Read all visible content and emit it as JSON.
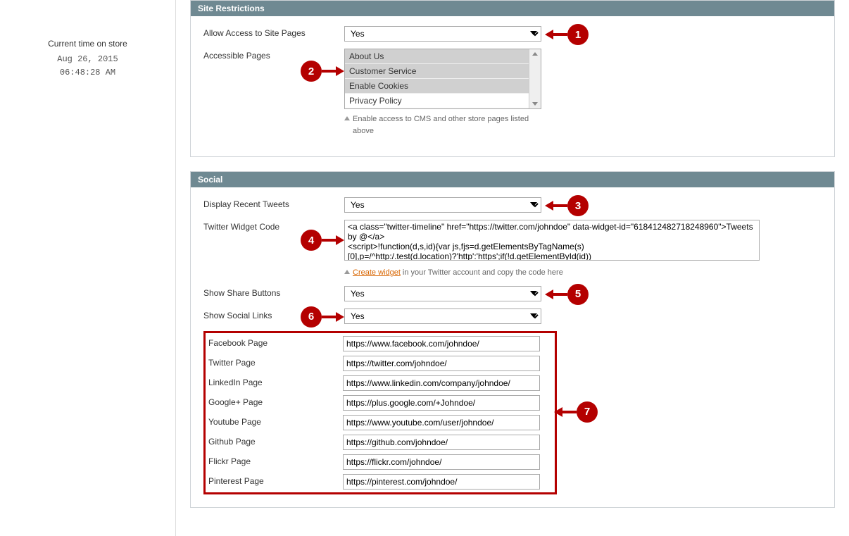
{
  "sidebar": {
    "time_label": "Current time on store",
    "time_date": "Aug 26, 2015",
    "time_clock": "06:48:28 AM"
  },
  "restrictions": {
    "title": "Site Restrictions",
    "allow_label": "Allow Access to Site Pages",
    "allow_value": "Yes",
    "accessible_label": "Accessible Pages",
    "options": [
      "About Us",
      "Customer Service",
      "Enable Cookies",
      "Privacy Policy"
    ],
    "hint": "Enable access to CMS and other store pages listed above"
  },
  "social": {
    "title": "Social",
    "display_tweets_label": "Display Recent Tweets",
    "display_tweets_value": "Yes",
    "twitter_code_label": "Twitter Widget Code",
    "twitter_code_value": "<a class=\"twitter-timeline\" href=\"https://twitter.com/johndoe\" data-widget-id=\"618412482718248960\">Tweets by @</a>\n<script>!function(d,s,id){var js,fjs=d.getElementsByTagName(s)[0],p=/^http:/.test(d.location)?'http':'https';if(!d.getElementById(id))",
    "twitter_hint_link": "Create widget",
    "twitter_hint_text": " in your Twitter account and copy the code here",
    "share_buttons_label": "Show Share Buttons",
    "share_buttons_value": "Yes",
    "social_links_label": "Show Social Links",
    "social_links_value": "Yes",
    "links": [
      {
        "label": "Facebook Page",
        "value": "https://www.facebook.com/johndoe/"
      },
      {
        "label": "Twitter Page",
        "value": "https://twitter.com/johndoe/"
      },
      {
        "label": "LinkedIn Page",
        "value": "https://www.linkedin.com/company/johndoe/"
      },
      {
        "label": "Google+ Page",
        "value": "https://plus.google.com/+Johndoe/"
      },
      {
        "label": "Youtube Page",
        "value": "https://www.youtube.com/user/johndoe/"
      },
      {
        "label": "Github Page",
        "value": "https://github.com/johndoe/"
      },
      {
        "label": "Flickr Page",
        "value": "https://flickr.com/johndoe/"
      },
      {
        "label": "Pinterest Page",
        "value": "https://pinterest.com/johndoe/"
      }
    ]
  },
  "annotations": [
    "1",
    "2",
    "3",
    "4",
    "5",
    "6",
    "7"
  ]
}
